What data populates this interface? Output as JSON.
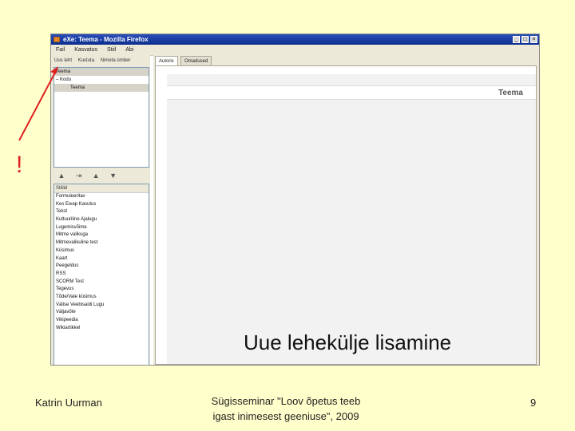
{
  "window": {
    "title": "eXe: Teema - Mozilla Firefox",
    "controls": [
      "_",
      "□",
      "×"
    ],
    "menus": [
      "Fail",
      "Kasvatus",
      "Stiil",
      "Abi"
    ]
  },
  "left_pane": {
    "tabs": [
      "Uus leht",
      "Kustuta",
      "Nimeta ümber"
    ],
    "outline": [
      {
        "label": "Teema",
        "indent": 0,
        "selected": true
      },
      {
        "label": "– Kodu",
        "indent": 0,
        "selected": false
      },
      {
        "label": "Teema",
        "indent": 2,
        "selected": true
      }
    ],
    "tools": [
      "arrow-up-icon",
      "indent-icon",
      "arrow-up-icon",
      "arrow-down-icon"
    ],
    "tool_glyphs": [
      "▲",
      "⇥",
      "▲",
      "▼"
    ],
    "styles_header": "Stiilid",
    "styles": [
      "Formuleeritav",
      "Kes Ewap Kasutus",
      "Tekst",
      "Kultuuriline Ajalugu",
      "Lugemisvõime",
      "Mitme valikuga",
      "Mitmevalikuline test",
      "Küsimus",
      "Kaart",
      "Peegeldus",
      "RSS",
      "SCORM Test",
      "Tegevus",
      "Tõde/Vale küsimus",
      "Välise Veebisaidi Lugu",
      "Väljavõte",
      "Vikipeedia",
      "Wikiartikkel"
    ]
  },
  "right_pane": {
    "tabs": [
      "Autoriv",
      "Omadused"
    ],
    "page_title": "Teema"
  },
  "annotation": {
    "mark": "!",
    "color": "#e02020"
  },
  "slide": {
    "caption": "Uue lehekülje lisamine",
    "author": "Katrin Uurman",
    "event_line1": "Sügisseminar \"Loov õpetus teeb",
    "event_line2": "igast inimesest geeniuse\", 2009",
    "page_number": "9",
    "background": "#FFFFCC"
  }
}
